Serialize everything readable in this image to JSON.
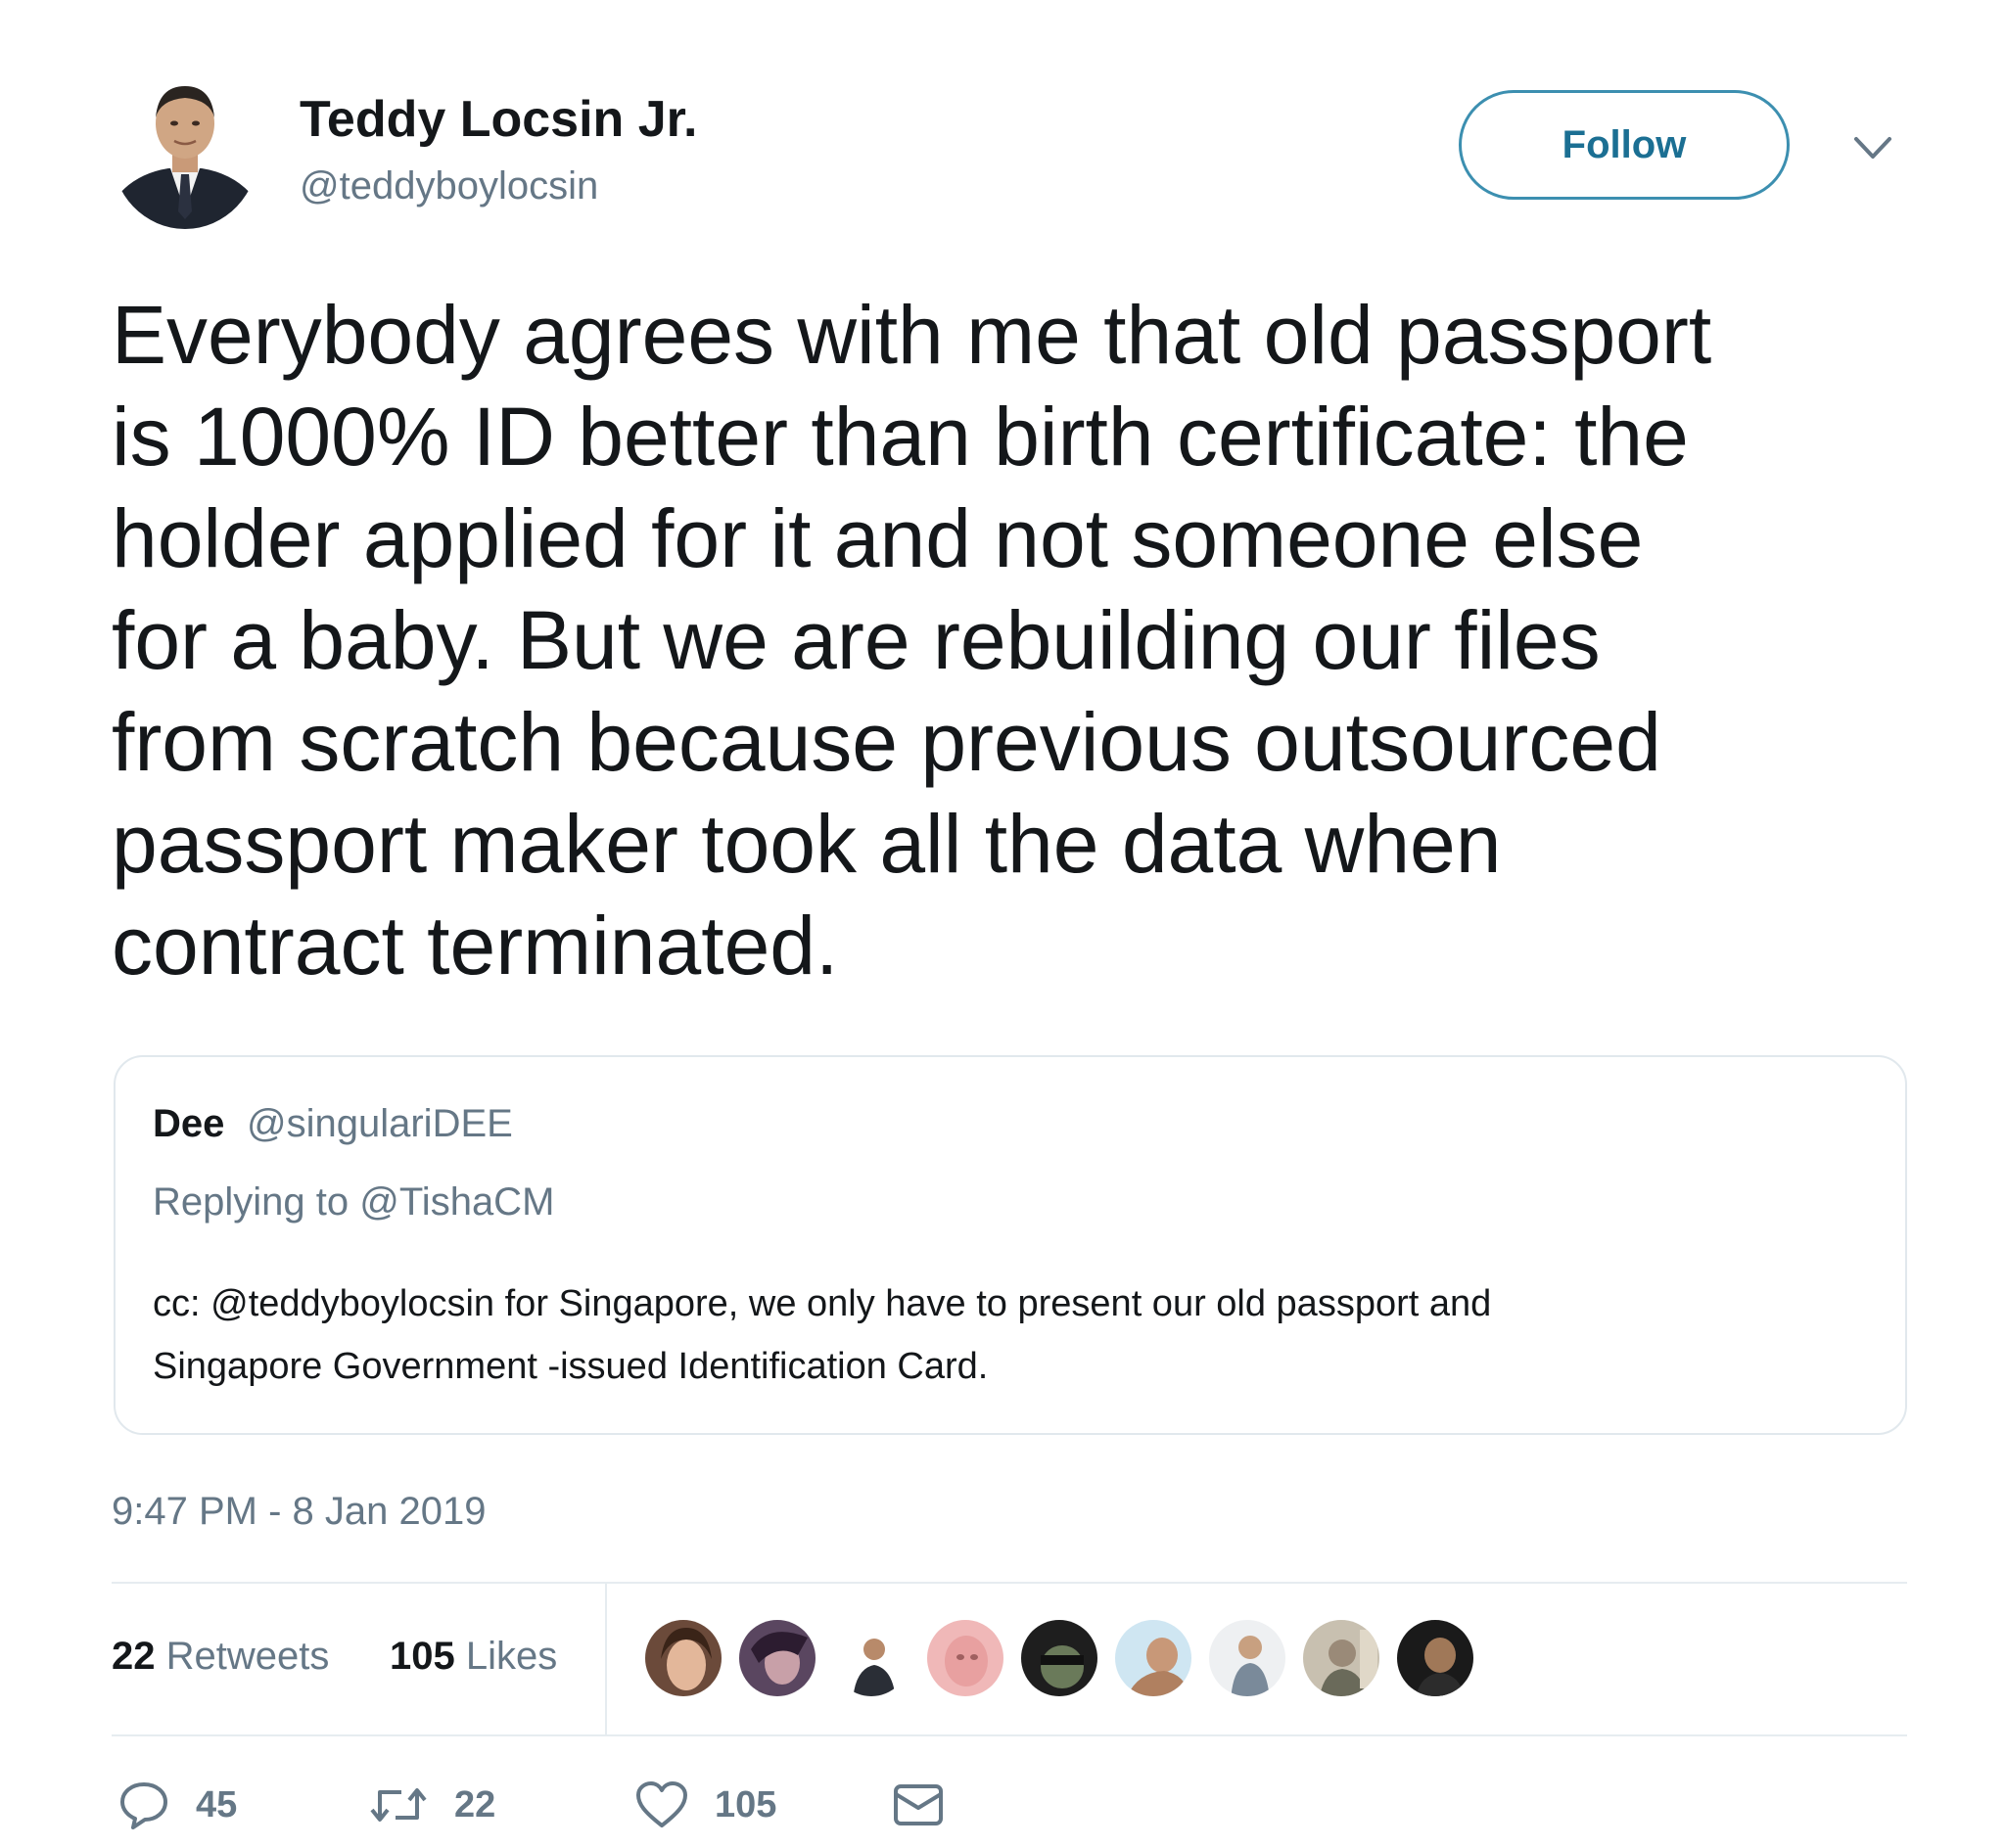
{
  "author": {
    "display_name": "Teddy Locsin Jr.",
    "handle": "@teddyboylocsin",
    "avatar_icon": "user-avatar-photo"
  },
  "follow_button": {
    "label": "Follow",
    "color": "#1b6f93"
  },
  "tweet": {
    "text_lines": [
      "Everybody agrees with me that old passport",
      "is 1000% ID better than birth certificate: the",
      "holder applied for it and not someone else",
      "for a baby. But we are rebuilding our files",
      "from scratch because previous outsourced",
      "passport maker took all the data when",
      "contract terminated."
    ],
    "timestamp": "9:47 PM - 8 Jan 2019"
  },
  "quoted_tweet": {
    "name": "Dee",
    "handle": "@singulariDEE",
    "replying_prefix": "Replying to",
    "replying_to": "@TishaCM",
    "text_lines": [
      "cc: @teddyboylocsin for Singapore, we only have to present our old passport and",
      "Singapore Government -issued Identification Card."
    ]
  },
  "stats": {
    "retweets_count": "22",
    "retweets_label": "Retweets",
    "likes_count": "105",
    "likes_label": "Likes",
    "liker_avatar_count_shown": 9
  },
  "actions": {
    "reply_count": "45",
    "retweet_count": "22",
    "like_count": "105",
    "reply_icon": "reply-icon",
    "retweet_icon": "retweet-icon",
    "like_icon": "heart-icon",
    "dm_icon": "envelope-icon"
  },
  "colors": {
    "text_primary": "#14171a",
    "text_secondary": "#657786",
    "divider": "#e6ecf0",
    "follow_border": "#3c8fb0"
  }
}
